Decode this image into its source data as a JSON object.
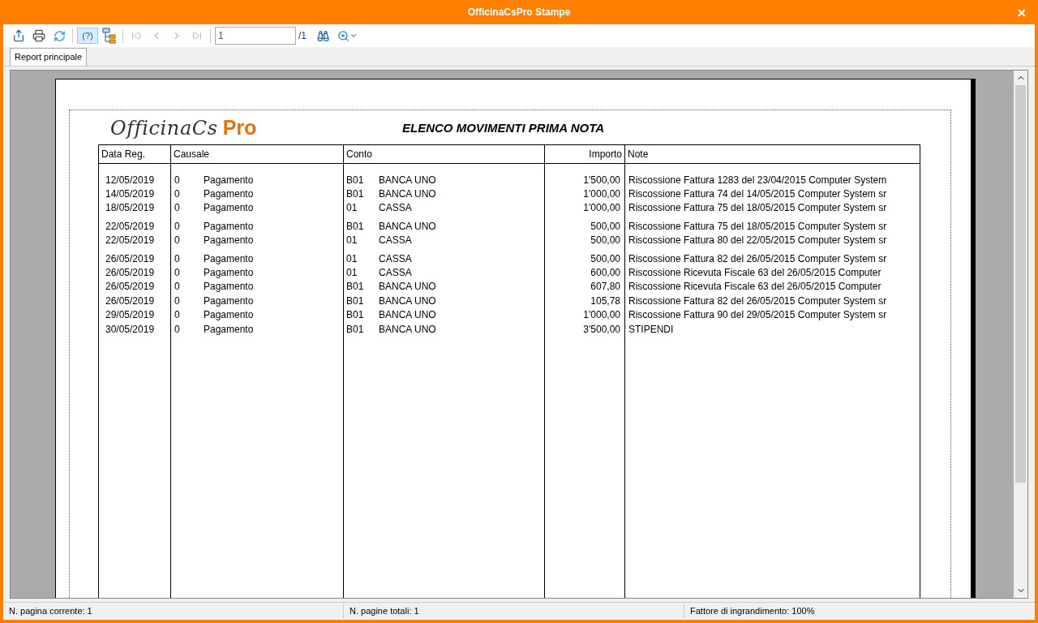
{
  "window": {
    "title": "OfficinaCsPro Stampe",
    "close": "✕"
  },
  "toolbar": {
    "help": "(?)",
    "page_field": "1",
    "page_total": "/1"
  },
  "tabs": [
    {
      "label": "Report principale",
      "selected": true
    }
  ],
  "report": {
    "logo_a": "OfficinaCs",
    "logo_b": "Pro",
    "title": "ELENCO MOVIMENTI PRIMA NOTA",
    "columns": [
      "Data Reg.",
      "Causale",
      "Conto",
      "Importo",
      "Note"
    ],
    "groups": [
      [
        {
          "date": "12/05/2019",
          "code": "0",
          "causale": "Pagamento",
          "acc": "B01",
          "conto": "BANCA UNO",
          "amount": "1'500,00",
          "note": "Riscossione Fattura 1283 del 23/04/2015 Computer System"
        },
        {
          "date": "14/05/2019",
          "code": "0",
          "causale": "Pagamento",
          "acc": "B01",
          "conto": "BANCA UNO",
          "amount": "1'000,00",
          "note": "Riscossione Fattura 74 del 14/05/2015 Computer System sr"
        },
        {
          "date": "18/05/2019",
          "code": "0",
          "causale": "Pagamento",
          "acc": "01",
          "conto": "CASSA",
          "amount": "1'000,00",
          "note": "Riscossione Fattura 75 del 18/05/2015 Computer System sr"
        }
      ],
      [
        {
          "date": "22/05/2019",
          "code": "0",
          "causale": "Pagamento",
          "acc": "B01",
          "conto": "BANCA UNO",
          "amount": "500,00",
          "note": "Riscossione Fattura 75 del 18/05/2015 Computer System sr"
        },
        {
          "date": "22/05/2019",
          "code": "0",
          "causale": "Pagamento",
          "acc": "01",
          "conto": "CASSA",
          "amount": "500,00",
          "note": "Riscossione Fattura 80 del 22/05/2015 Computer System sr"
        }
      ],
      [
        {
          "date": "26/05/2019",
          "code": "0",
          "causale": "Pagamento",
          "acc": "01",
          "conto": "CASSA",
          "amount": "500,00",
          "note": "Riscossione Fattura 82 del 26/05/2015 Computer System sr"
        },
        {
          "date": "26/05/2019",
          "code": "0",
          "causale": "Pagamento",
          "acc": "01",
          "conto": "CASSA",
          "amount": "600,00",
          "note": "Riscossione Ricevuta Fiscale 63 del 26/05/2015 Computer"
        },
        {
          "date": "26/05/2019",
          "code": "0",
          "causale": "Pagamento",
          "acc": "B01",
          "conto": "BANCA UNO",
          "amount": "607,80",
          "note": "Riscossione Ricevuta Fiscale 63 del 26/05/2015 Computer"
        },
        {
          "date": "26/05/2019",
          "code": "0",
          "causale": "Pagamento",
          "acc": "B01",
          "conto": "BANCA UNO",
          "amount": "105,78",
          "note": "Riscossione Fattura 82 del 26/05/2015 Computer System sr"
        },
        {
          "date": "29/05/2019",
          "code": "0",
          "causale": "Pagamento",
          "acc": "B01",
          "conto": "BANCA UNO",
          "amount": "1'000,00",
          "note": "Riscossione Fattura 90 del 29/05/2015 Computer System sr"
        },
        {
          "date": "30/05/2019",
          "code": "0",
          "causale": "Pagamento",
          "acc": "B01",
          "conto": "BANCA UNO",
          "amount": "3'500,00",
          "note": "STIPENDI"
        }
      ]
    ]
  },
  "status_bar": [
    "N. pagina corrente: 1",
    "N. pagine totali: 1",
    "Fattore di ingrandimento: 100%"
  ]
}
